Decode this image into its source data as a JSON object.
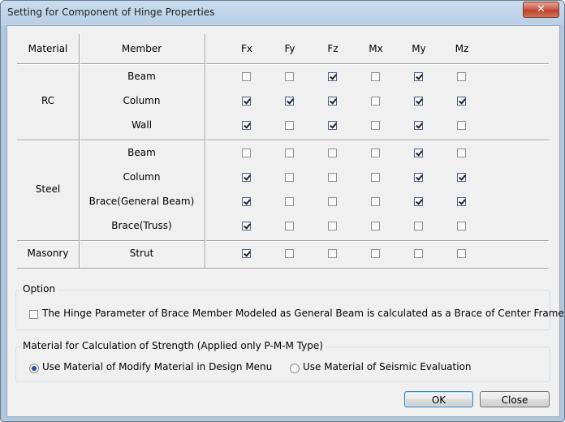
{
  "window": {
    "title": "Setting for Component of Hinge Properties",
    "close_glyph": "✕"
  },
  "table": {
    "headers": {
      "material": "Material",
      "member": "Member",
      "components": [
        "Fx",
        "Fy",
        "Fz",
        "Mx",
        "My",
        "Mz"
      ]
    },
    "groups": [
      {
        "material": "RC",
        "rows": [
          {
            "member": "Beam",
            "checks": [
              false,
              false,
              true,
              false,
              true,
              false
            ]
          },
          {
            "member": "Column",
            "checks": [
              true,
              true,
              true,
              false,
              true,
              true
            ]
          },
          {
            "member": "Wall",
            "checks": [
              true,
              false,
              true,
              false,
              true,
              false
            ]
          }
        ]
      },
      {
        "material": "Steel",
        "rows": [
          {
            "member": "Beam",
            "checks": [
              false,
              false,
              false,
              false,
              true,
              false
            ]
          },
          {
            "member": "Column",
            "checks": [
              true,
              false,
              false,
              false,
              true,
              true
            ]
          },
          {
            "member": "Brace(General Beam)",
            "checks": [
              true,
              false,
              false,
              false,
              true,
              true
            ]
          },
          {
            "member": "Brace(Truss)",
            "checks": [
              true,
              false,
              false,
              false,
              false,
              false
            ]
          }
        ]
      },
      {
        "material": "Masonry",
        "rows": [
          {
            "member": "Strut",
            "checks": [
              true,
              false,
              false,
              false,
              false,
              false
            ]
          }
        ]
      }
    ]
  },
  "option": {
    "title": "Option",
    "brace_checkbox": {
      "label": "The Hinge Parameter of Brace Member Modeled as General Beam is calculated as a Brace of Center Frame",
      "checked": false
    }
  },
  "strength": {
    "title": "Material for Calculation of Strength (Applied only P-M-M Type)",
    "options": [
      {
        "label": "Use Material of Modify Material in Design Menu",
        "selected": true
      },
      {
        "label": "Use Material of Seismic Evaluation",
        "selected": false
      }
    ]
  },
  "buttons": {
    "ok": "OK",
    "close": "Close"
  }
}
